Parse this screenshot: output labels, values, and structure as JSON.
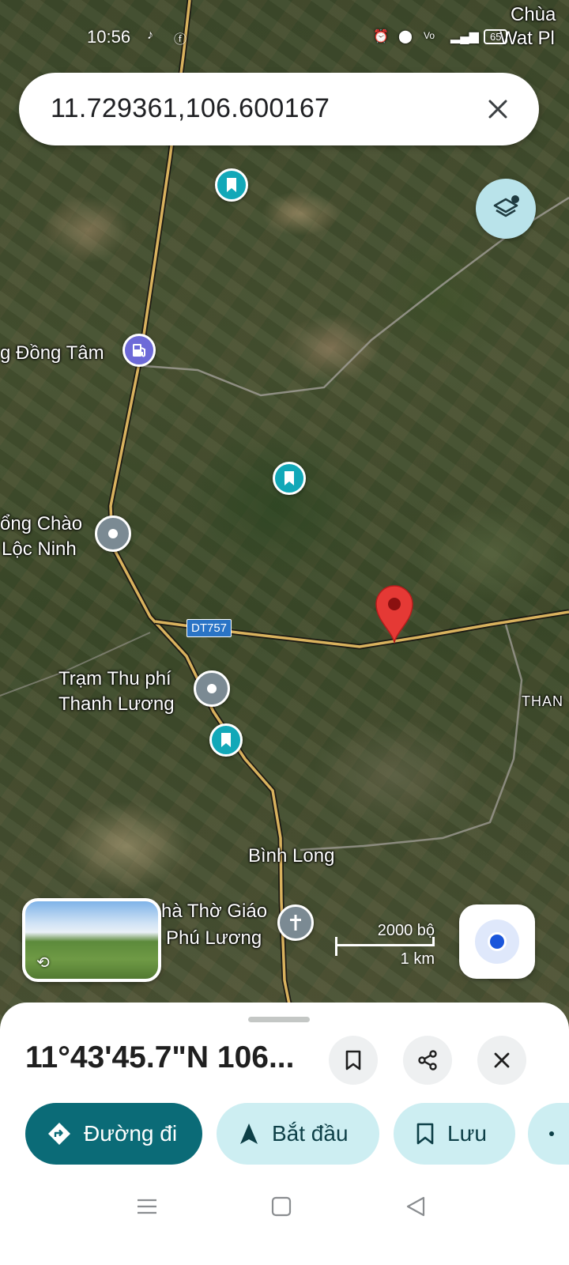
{
  "status_bar": {
    "time": "10:56",
    "battery": "65"
  },
  "search": {
    "query": "11.729361,106.600167"
  },
  "map": {
    "labels": {
      "top_right_line1": "Chùa",
      "top_right_line2": "Wat Pl",
      "dong_tam": "g Đồng Tâm",
      "cong_chao_line1": "ổng Chào",
      "cong_chao_line2": "Lộc Ninh",
      "road": "DT757",
      "tram_line1": "Trạm Thu phí",
      "tram_line2": "Thanh Lương",
      "than": "THAN",
      "binh_long": "Bình Long",
      "church_line1": "hà Thờ Giáo",
      "church_line2": "Phú Lương"
    },
    "scale": {
      "imperial": "2000 bộ",
      "metric": "1 km"
    }
  },
  "sheet": {
    "coordinates": "11°43'45.7\"N 106...",
    "actions": {
      "directions": "Đường đi",
      "start": "Bắt đầu",
      "save": "Lưu"
    }
  },
  "colors": {
    "primary": "#0b6b77",
    "tonal": "#cdeef2",
    "pin_red": "#e53935",
    "pin_teal": "#12a8b8",
    "location_dot": "#1a56db"
  }
}
